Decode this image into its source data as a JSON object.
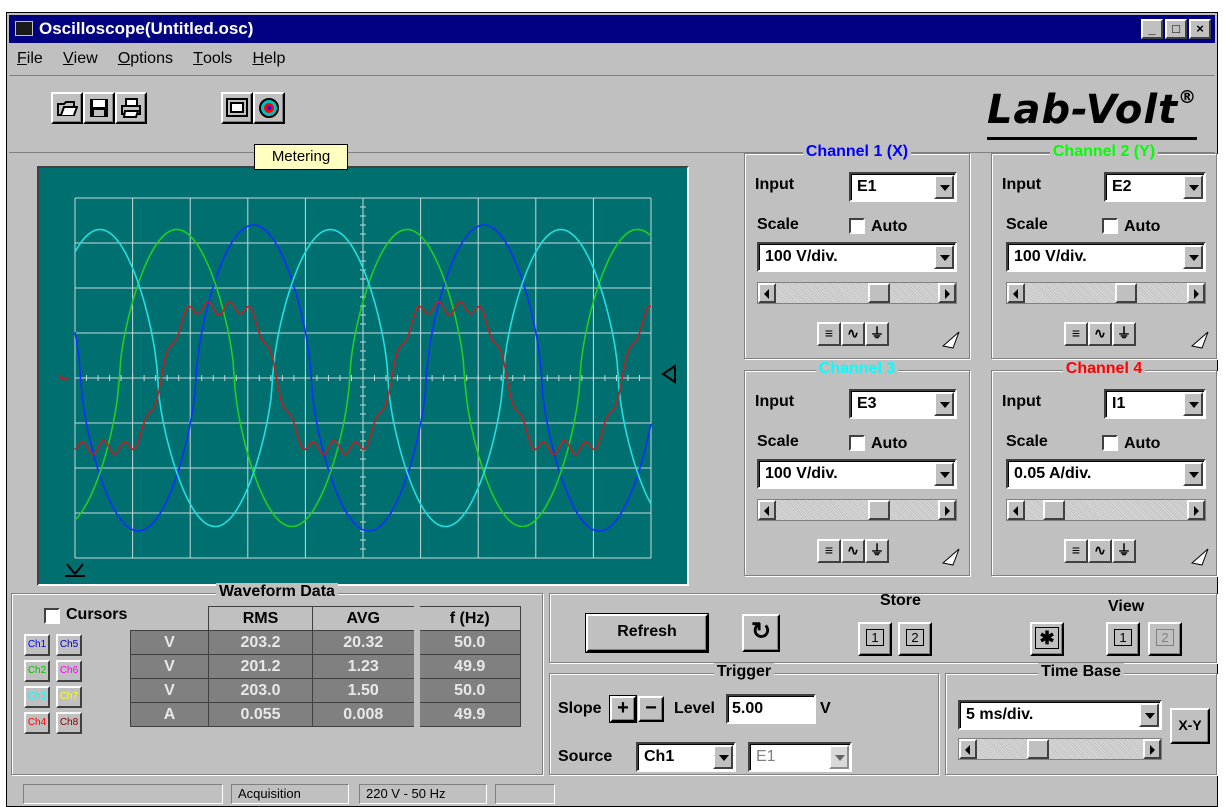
{
  "window": {
    "title": "Oscilloscope(Untitled.osc)",
    "min": "_",
    "max": "□",
    "close": "×"
  },
  "menu": {
    "file": {
      "hot": "F",
      "rest": "ile"
    },
    "view": {
      "hot": "V",
      "rest": "iew"
    },
    "options": {
      "hot": "O",
      "rest": "ptions"
    },
    "tools": {
      "hot": "T",
      "rest": "ools"
    },
    "help": {
      "hot": "H",
      "rest": "elp"
    }
  },
  "tooltip": "Metering",
  "logo": {
    "text": "Lab-Volt",
    "reg": "®"
  },
  "channels": {
    "ch1": {
      "title": "Channel 1 (X)",
      "color": "#0000ff",
      "input_label": "Input",
      "input": "E1",
      "scale_label": "Scale",
      "auto": "Auto",
      "scale": "100 V/div."
    },
    "ch2": {
      "title": "Channel 2 (Y)",
      "color": "#00ff00",
      "input_label": "Input",
      "input": "E2",
      "scale_label": "Scale",
      "auto": "Auto",
      "scale": "100 V/div."
    },
    "ch3": {
      "title": "Channel 3",
      "color": "#00ffff",
      "input_label": "Input",
      "input": "E3",
      "scale_label": "Scale",
      "auto": "Auto",
      "scale": "100 V/div."
    },
    "ch4": {
      "title": "Channel 4",
      "color": "#ff0000",
      "input_label": "Input",
      "input": "I1",
      "scale_label": "Scale",
      "auto": "Auto",
      "scale": "0.05 A/div."
    }
  },
  "waveform": {
    "title": "Waveform Data",
    "cursors": "Cursors",
    "headers": [
      "RMS",
      "AVG",
      "f (Hz)"
    ],
    "rows": [
      {
        "a": "Ch1",
        "b": "Ch5",
        "ca": "#0000ff",
        "cb": "#0000c0",
        "unit": "V",
        "rms": "203.2",
        "avg": "20.32",
        "f": "50.0"
      },
      {
        "a": "Ch2",
        "b": "Ch6",
        "ca": "#00c000",
        "cb": "#ff00ff",
        "unit": "V",
        "rms": "201.2",
        "avg": "1.23",
        "f": "49.9"
      },
      {
        "a": "Ch3",
        "b": "Ch7",
        "ca": "#00ffff",
        "cb": "#ffff00",
        "unit": "V",
        "rms": "203.0",
        "avg": "1.50",
        "f": "50.0"
      },
      {
        "a": "Ch4",
        "b": "Ch8",
        "ca": "#ff0000",
        "cb": "#800000",
        "unit": "A",
        "rms": "0.055",
        "avg": "0.008",
        "f": "49.9"
      }
    ]
  },
  "controls": {
    "refresh": "Refresh",
    "store": "Store",
    "view": "View",
    "store1": "1",
    "store2": "2",
    "view1": "1",
    "view2": "2"
  },
  "trigger": {
    "title": "Trigger",
    "slope": "Slope",
    "level": "Level",
    "level_value": "5.00",
    "unit": "V",
    "source": "Source",
    "source_value": "Ch1",
    "source_input": "E1"
  },
  "timebase": {
    "title": "Time Base",
    "value": "5 ms/div.",
    "xy": "X-Y"
  },
  "statusbar": {
    "mode": "Acquisition",
    "supply": "220 V - 50 Hz"
  }
}
